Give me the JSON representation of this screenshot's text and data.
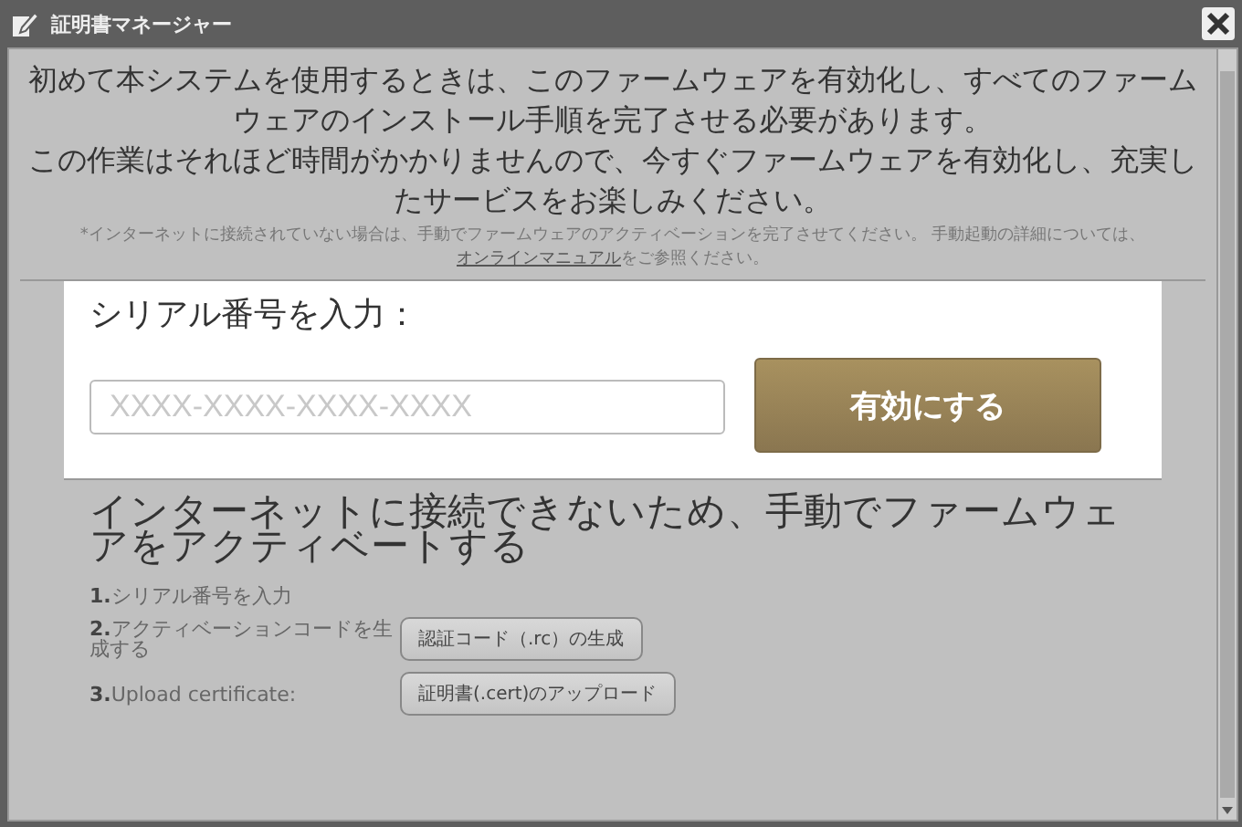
{
  "window": {
    "title": "証明書マネージャー"
  },
  "intro": [
    "初めて本システムを使用するときは、このファームウェアを有効化し、すべてのファームウェアのインストール手順を完了させる必要があります。",
    "この作業はそれほど時間がかかりませんので、今すぐファームウェアを有効化し、充実したサービスをお楽しみください。"
  ],
  "note": {
    "text": "*インターネットに接続されていない場合は、手動でファームウェアのアクティベーションを完了させてください。 手動起動の詳細については、",
    "link": "オンラインマニュアル",
    "after": "をご参照ください。"
  },
  "serial": {
    "label": "シリアル番号を入力：",
    "placeholder": "XXXX-XXXX-XXXX-XXXX",
    "button": "有効にする"
  },
  "manual": {
    "heading": "インターネットに接続できないため、手動でファームウェアをアクティベートする",
    "steps": [
      {
        "number": "1.",
        "label": "シリアル番号を入力"
      },
      {
        "number": "2.",
        "label": "アクティベーションコードを生成する",
        "button": "認証コード（.rc）の生成"
      },
      {
        "number": "3.",
        "label": "Upload certificate:",
        "button": "証明書(.cert)のアップロード"
      }
    ]
  }
}
